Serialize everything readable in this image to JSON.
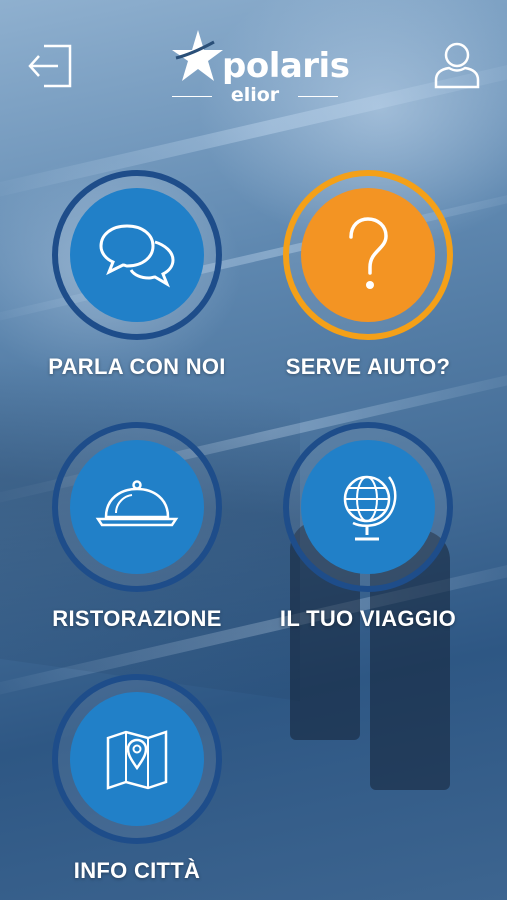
{
  "header": {
    "logo_text": "polaris",
    "logo_sub": "elior",
    "logout_icon": "logout-icon",
    "profile_icon": "user-icon"
  },
  "tiles": [
    {
      "label": "Parla con noi",
      "icon": "chat-bubbles-icon",
      "color": "#2180c8"
    },
    {
      "label": "Serve aiuto?",
      "icon": "question-mark-icon",
      "color": "#f39423"
    },
    {
      "label": "Ristorazione",
      "icon": "food-cloche-icon",
      "color": "#2180c8"
    },
    {
      "label": "Il tuo viaggio",
      "icon": "globe-icon",
      "color": "#2180c8"
    },
    {
      "label": "Info città",
      "icon": "map-pin-icon",
      "color": "#2180c8"
    }
  ],
  "colors": {
    "accent_blue": "#2180c8",
    "accent_orange": "#f39423",
    "ring_blue": "#1e4d8a"
  }
}
